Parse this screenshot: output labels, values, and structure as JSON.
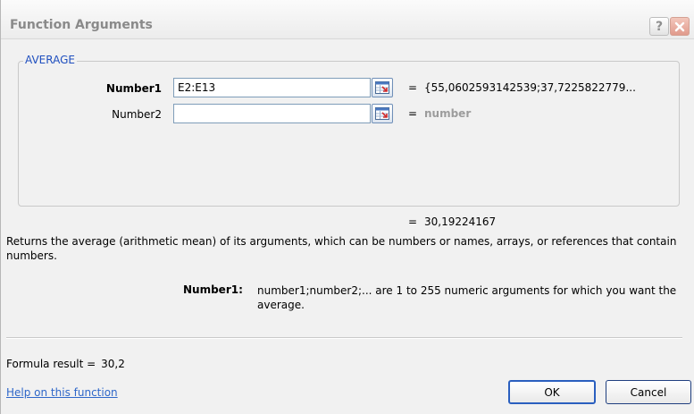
{
  "dialog": {
    "title": "Function Arguments",
    "help_glyph": "?",
    "function_name": "AVERAGE",
    "args": [
      {
        "label": "Number1",
        "value": "E2:E13",
        "result": "{55,0602593142539;37,7225822779...",
        "bold": true
      },
      {
        "label": "Number2",
        "value": "",
        "result": "number",
        "bold": false
      }
    ],
    "eq": "=",
    "function_result": "30,19224167",
    "description": "Returns the average (arithmetic mean) of its arguments, which can be numbers or names, arrays, or references that contain numbers.",
    "param_name": "Number1:",
    "param_description": "number1;number2;... are 1 to 255 numeric arguments for which you want the average.",
    "formula_result_label": "Formula result =",
    "formula_result_value": "30,2",
    "help_link": "Help on this function",
    "ok_label": "OK",
    "cancel_label": "Cancel"
  },
  "colors": {
    "accent_blue": "#1f4fbf",
    "link": "#2f67c9",
    "hint_gray": "#9c9c9c",
    "close_red": "#e19a8c"
  },
  "icons": {
    "help": "question-mark-icon",
    "close": "close-icon",
    "ref": "collapse-dialog-icon"
  }
}
